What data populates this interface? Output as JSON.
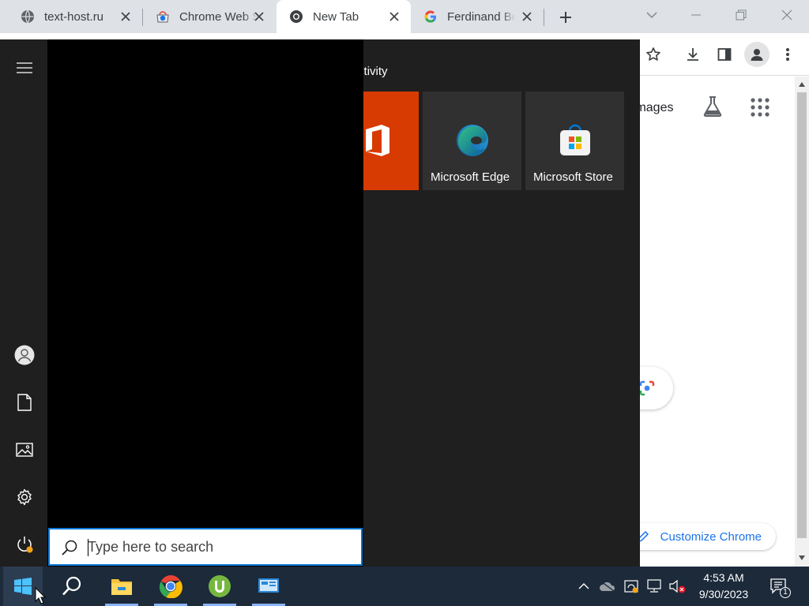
{
  "browser": {
    "tabs": [
      {
        "title": "text-host.ru",
        "icon": "globe-icon",
        "active": false
      },
      {
        "title": "Chrome Web Store",
        "icon": "chrome-web-store-icon",
        "active": false
      },
      {
        "title": "New Tab",
        "icon": "chrome-icon",
        "active": true
      },
      {
        "title": "Ferdinand Be",
        "icon": "google-icon",
        "active": false
      }
    ],
    "page": {
      "images_link": "Images",
      "customize_label": "Customize Chrome"
    }
  },
  "start_menu": {
    "group_title": "Productivity",
    "tiles": [
      {
        "label": "",
        "icon": "office-icon"
      },
      {
        "label": "Microsoft Edge",
        "icon": "edge-icon"
      },
      {
        "label": "Microsoft Store",
        "icon": "store-icon"
      }
    ],
    "rail": [
      "hamburger-icon",
      "user-icon",
      "documents-icon",
      "pictures-icon",
      "settings-icon",
      "power-icon"
    ]
  },
  "search": {
    "placeholder": "Type here to search"
  },
  "taskbar": {
    "pinned": [
      "file-explorer-icon",
      "chrome-icon",
      "utorrent-icon",
      "control-panel-icon"
    ],
    "clock": {
      "time": "4:53 AM",
      "date": "9/30/2023"
    },
    "notification_count": "1"
  },
  "colors": {
    "accent": "#0078d7",
    "office_tile": "#d83b01",
    "taskbar": "#1c2a3a",
    "start_menu": "#1f1f1f",
    "chrome_blue": "#1a73e8"
  }
}
